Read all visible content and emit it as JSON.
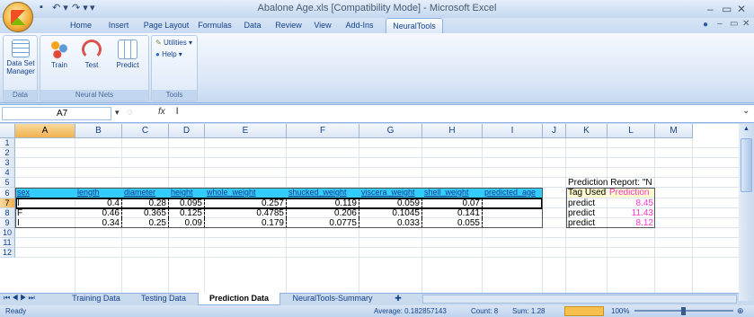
{
  "window": {
    "title": "Abalone Age.xls  [Compatibility Mode]  -  Microsoft Excel",
    "min": "–",
    "restore": "▭",
    "close": "✕",
    "wb_min": "–",
    "wb_restore": "▭",
    "wb_close": "✕"
  },
  "qat": {
    "save": "▪",
    "undo": "↶ ▾",
    "redo": "↷ ▾",
    "extra": "▾"
  },
  "tabs": [
    "Home",
    "Insert",
    "Page Layout",
    "Formulas",
    "Data",
    "Review",
    "View",
    "Add-Ins",
    "NeuralTools"
  ],
  "ribbon": {
    "data_group": {
      "label": "Data",
      "button": "Data Set Manager"
    },
    "nn_group": {
      "label": "Neural Nets",
      "train": "Train",
      "test": "Test",
      "predict": "Predict"
    },
    "tools_group": {
      "label": "Tools",
      "utilities": "Utilities ▾",
      "help": "Help ▾"
    }
  },
  "formula_bar": {
    "name_box": "A7",
    "fx": "fx",
    "value": "l"
  },
  "columns": [
    "A",
    "B",
    "C",
    "D",
    "E",
    "F",
    "G",
    "H",
    "I",
    "J",
    "K",
    "L",
    "M"
  ],
  "rows": [
    "1",
    "2",
    "3",
    "4",
    "5",
    "6",
    "7",
    "8",
    "9",
    "10",
    "11",
    "12"
  ],
  "table": {
    "headers": [
      "sex",
      "length",
      "diameter",
      "height",
      "whole_weight",
      "shucked_weight",
      "viscera_weight",
      "shell_weight",
      "predicted_age"
    ],
    "rows": [
      [
        "I",
        "0.4",
        "0.28",
        "0.095",
        "0.257",
        "0.119",
        "0.059",
        "0.07"
      ],
      [
        "F",
        "0.46",
        "0.365",
        "0.125",
        "0.4785",
        "0.206",
        "0.1045",
        "0.141"
      ],
      [
        "I",
        "0.34",
        "0.25",
        "0.09",
        "0.179",
        "0.0775",
        "0.033",
        "0.055"
      ]
    ]
  },
  "report": {
    "title": "Prediction Report: \"N",
    "tag_header": "Tag Used",
    "pred_header": "Prediction",
    "tags": [
      "predict",
      "predict",
      "predict"
    ],
    "values": [
      "8.45",
      "11.43",
      "8.12"
    ]
  },
  "sheet_tabs": [
    "Training Data",
    "Testing Data",
    "Prediction Data",
    "NeuralTools-Summary"
  ],
  "status": {
    "ready": "Ready",
    "average": "Average: 0.182857143",
    "count": "Count: 8",
    "sum": "Sum: 1.28",
    "zoom": "100%"
  },
  "colors": {
    "header_fill": "#33ccff",
    "prediction": "#ff33cc",
    "selected": "#f1b24e"
  }
}
